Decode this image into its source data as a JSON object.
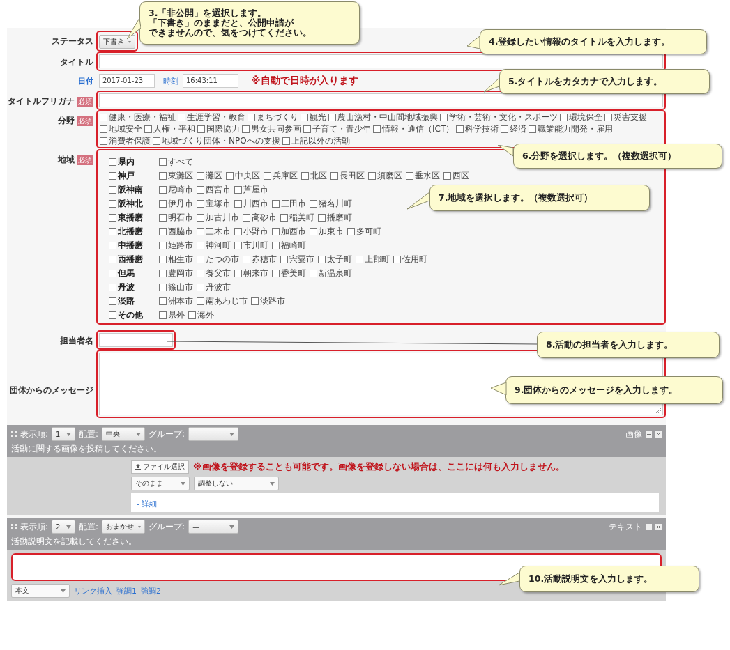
{
  "status": {
    "label": "ステータス",
    "value": "下書き",
    "highlighted": true
  },
  "title": {
    "label": "タイトル",
    "highlighted": true
  },
  "date": {
    "label": "日付",
    "value": "2017-01-23",
    "time_label": "時刻",
    "time_value": "16:43:11",
    "note": "※自動で日時が入ります",
    "highlighted": false
  },
  "furigana": {
    "label": "タイトルフリガナ",
    "required": "必須",
    "highlighted": true
  },
  "fields": {
    "label": "分野",
    "required": "必須",
    "highlighted": true,
    "options": [
      {
        "label": "健康・医療・福祉",
        "checked": false
      },
      {
        "label": "生涯学習・教育",
        "checked": false
      },
      {
        "label": "まちづくり",
        "checked": false
      },
      {
        "label": "観光",
        "checked": false
      },
      {
        "label": "農山漁村・中山間地域振興",
        "checked": false
      },
      {
        "label": "学術・芸術・文化・スポーツ",
        "checked": false
      },
      {
        "label": "環境保全",
        "checked": false
      },
      {
        "label": "災害支援",
        "checked": false
      },
      {
        "label": "地域安全",
        "checked": false
      },
      {
        "label": "人権・平和",
        "checked": false
      },
      {
        "label": "国際協力",
        "checked": false
      },
      {
        "label": "男女共同参画",
        "checked": false
      },
      {
        "label": "子育て・青少年",
        "checked": false
      },
      {
        "label": "情報・通信（ICT）",
        "checked": false
      },
      {
        "label": "科学技術",
        "checked": false
      },
      {
        "label": "経済",
        "checked": false
      },
      {
        "label": "職業能力開発・雇用",
        "checked": false
      },
      {
        "label": "消費者保護",
        "checked": false
      },
      {
        "label": "地域づくり団体・NPOへの支援",
        "checked": false
      },
      {
        "label": "上記以外の活動",
        "checked": false
      }
    ]
  },
  "regions": {
    "label": "地域",
    "required": "必須",
    "highlighted": true,
    "groups": [
      {
        "name": "県内",
        "checked": false,
        "options": [
          {
            "label": "すべて",
            "checked": false
          }
        ]
      },
      {
        "name": "神戸",
        "checked": false,
        "options": [
          {
            "label": "東灘区",
            "checked": false
          },
          {
            "label": "灘区",
            "checked": false
          },
          {
            "label": "中央区",
            "checked": false
          },
          {
            "label": "兵庫区",
            "checked": false
          },
          {
            "label": "北区",
            "checked": false
          },
          {
            "label": "長田区",
            "checked": false
          },
          {
            "label": "須磨区",
            "checked": false
          },
          {
            "label": "垂水区",
            "checked": false
          },
          {
            "label": "西区",
            "checked": false
          }
        ]
      },
      {
        "name": "阪神南",
        "checked": false,
        "options": [
          {
            "label": "尼崎市",
            "checked": false
          },
          {
            "label": "西宮市",
            "checked": false
          },
          {
            "label": "芦屋市",
            "checked": false
          }
        ]
      },
      {
        "name": "阪神北",
        "checked": false,
        "options": [
          {
            "label": "伊丹市",
            "checked": false
          },
          {
            "label": "宝塚市",
            "checked": false
          },
          {
            "label": "川西市",
            "checked": false
          },
          {
            "label": "三田市",
            "checked": false
          },
          {
            "label": "猪名川町",
            "checked": false
          }
        ]
      },
      {
        "name": "東播磨",
        "checked": false,
        "options": [
          {
            "label": "明石市",
            "checked": false
          },
          {
            "label": "加古川市",
            "checked": false
          },
          {
            "label": "高砂市",
            "checked": false
          },
          {
            "label": "稲美町",
            "checked": false
          },
          {
            "label": "播磨町",
            "checked": false
          }
        ]
      },
      {
        "name": "北播磨",
        "checked": false,
        "options": [
          {
            "label": "西脇市",
            "checked": false
          },
          {
            "label": "三木市",
            "checked": false
          },
          {
            "label": "小野市",
            "checked": false
          },
          {
            "label": "加西市",
            "checked": false
          },
          {
            "label": "加東市",
            "checked": false
          },
          {
            "label": "多可町",
            "checked": false
          }
        ]
      },
      {
        "name": "中播磨",
        "checked": false,
        "options": [
          {
            "label": "姫路市",
            "checked": false
          },
          {
            "label": "神河町",
            "checked": false
          },
          {
            "label": "市川町",
            "checked": false
          },
          {
            "label": "福崎町",
            "checked": false
          }
        ]
      },
      {
        "name": "西播磨",
        "checked": false,
        "options": [
          {
            "label": "相生市",
            "checked": false
          },
          {
            "label": "たつの市",
            "checked": false
          },
          {
            "label": "赤穂市",
            "checked": false
          },
          {
            "label": "宍粟市",
            "checked": false
          },
          {
            "label": "太子町",
            "checked": false
          },
          {
            "label": "上郡町",
            "checked": false
          },
          {
            "label": "佐用町",
            "checked": false
          }
        ]
      },
      {
        "name": "但馬",
        "checked": false,
        "options": [
          {
            "label": "豊岡市",
            "checked": false
          },
          {
            "label": "養父市",
            "checked": false
          },
          {
            "label": "朝来市",
            "checked": false
          },
          {
            "label": "香美町",
            "checked": false
          },
          {
            "label": "新温泉町",
            "checked": false
          }
        ]
      },
      {
        "name": "丹波",
        "checked": false,
        "options": [
          {
            "label": "篠山市",
            "checked": false
          },
          {
            "label": "丹波市",
            "checked": false
          }
        ]
      },
      {
        "name": "淡路",
        "checked": false,
        "options": [
          {
            "label": "洲本市",
            "checked": false
          },
          {
            "label": "南あわじ市",
            "checked": false
          },
          {
            "label": "淡路市",
            "checked": false
          }
        ]
      },
      {
        "name": "その他",
        "checked": false,
        "options": [
          {
            "label": "県外",
            "checked": false
          },
          {
            "label": "海外",
            "checked": false
          }
        ]
      }
    ]
  },
  "contact": {
    "label": "担当者名",
    "highlighted": true
  },
  "message": {
    "label": "団体からのメッセージ",
    "highlighted": true
  },
  "blocks": [
    {
      "kind": "image",
      "order_label": "表示順:",
      "order": "1",
      "align_label": "配置:",
      "align": "中央",
      "group_label": "グループ:",
      "group": "—",
      "type": "画像",
      "description": "活動に関する画像を投稿してください。",
      "file_button": "ファイル選択",
      "note": "※画像を登録することも可能です。画像を登録しない場合は、ここには何も入力しません。",
      "selects": [
        "そのまま",
        "調整しない"
      ],
      "detail_link": "- 詳細"
    },
    {
      "kind": "text",
      "order_label": "表示順:",
      "order": "2",
      "align_label": "配置:",
      "align": "おまかせ",
      "group_label": "グループ:",
      "group": "—",
      "type": "テキスト",
      "description": "活動説明文を記載してください。",
      "highlighted": true,
      "format": "本文",
      "links": [
        "リンク挿入",
        "強調1",
        "強調2"
      ]
    }
  ],
  "callouts": [
    {
      "lines": [
        "3.「非公開」を選択します。",
        "「下書き」のままだと、公開申請が",
        "できませんので、気をつけてください。"
      ]
    },
    {
      "lines": [
        "4.登録したい情報のタイトルを入力します。"
      ]
    },
    {
      "lines": [
        "5.タイトルをカタカナで入力します。"
      ]
    },
    {
      "lines": [
        "6.分野を選択します。（複数選択可）"
      ]
    },
    {
      "lines": [
        "7.地域を選択します。（複数選択可）"
      ]
    },
    {
      "lines": [
        "8.活動の担当者を入力します。"
      ]
    },
    {
      "lines": [
        "9.団体からのメッセージを入力します。"
      ]
    },
    {
      "lines": [
        "10.活動説明文を入力します。"
      ]
    }
  ]
}
